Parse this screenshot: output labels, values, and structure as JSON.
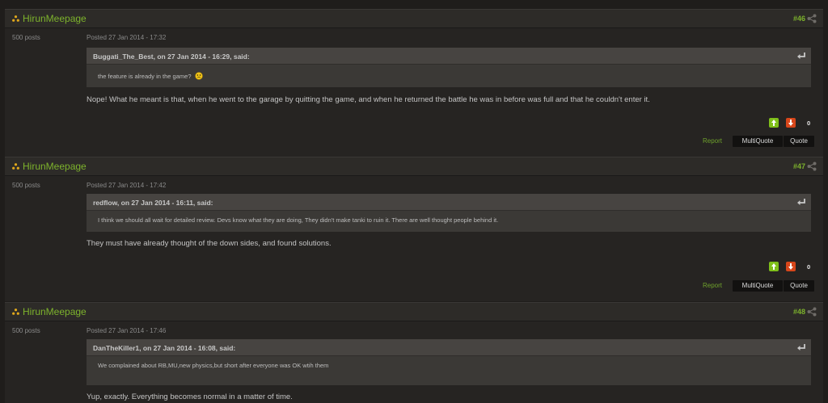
{
  "posts": [
    {
      "author": "HirunMeepage",
      "number": "#46",
      "posts_count": "500 posts",
      "posted": "Posted 27 Jan 2014 - 17:32",
      "quote_cite": "Buggati_The_Best, on 27 Jan 2014 - 16:29, said:",
      "quote_text": "the feature is already in the game?",
      "body": "Nope! What he meant is that, when he went to the garage by quitting the game, and when he returned the battle he was in before was full and that he couldn't enter it.",
      "score": "0",
      "report": "Report",
      "multiquote": "MultiQuote",
      "quote_btn": "Quote"
    },
    {
      "author": "HirunMeepage",
      "number": "#47",
      "posts_count": "500 posts",
      "posted": "Posted 27 Jan 2014 - 17:42",
      "quote_cite": "redflow, on 27 Jan 2014 - 16:11, said:",
      "quote_text": "I think we should all wait for detailed review. Devs know what they are doing, They didn't make tanki to ruin it. There are well thought people behind it.",
      "body": "They must have already thought of the down sides, and found solutions.",
      "score": "0",
      "report": "Report",
      "multiquote": "MultiQuote",
      "quote_btn": "Quote"
    },
    {
      "author": "HirunMeepage",
      "number": "#48",
      "posts_count": "500 posts",
      "posted": "Posted 27 Jan 2014 - 17:46",
      "quote_cite": "DanTheKiller1, on 27 Jan 2014 - 16:08, said:",
      "quote_text": "We complained about RB,MU,new physics,but short after everyone was OK wtih them",
      "body": "Yup, exactly. Everything becomes normal in a matter of time."
    }
  ],
  "colors": {
    "accent_green": "#7db32c",
    "vote_up": "#7fbf1a",
    "vote_down": "#d7461a"
  }
}
